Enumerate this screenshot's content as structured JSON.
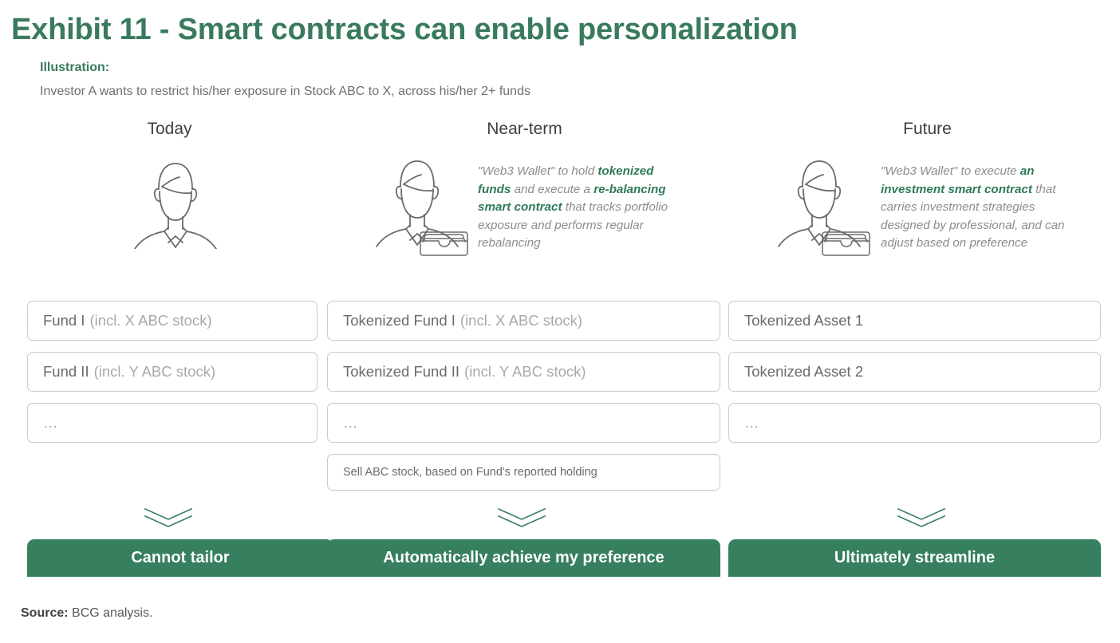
{
  "header": {
    "title": "Exhibit 11 - Smart contracts can enable personalization",
    "illustration_label": "Illustration:",
    "illustration_text": "Investor A wants to restrict his/her exposure in Stock ABC to X, across his/her 2+ funds"
  },
  "colors": {
    "brand_green": "#3a7a5e",
    "bar_green": "#367f5f",
    "highlight_green": "#2f7a57",
    "body_gray": "#6d6e71",
    "muted_gray": "#a7a9ab",
    "box_border": "#c9cacb",
    "icon_stroke": "#6a6b6d"
  },
  "columns": [
    {
      "header": "Today",
      "icon": "person-icon",
      "has_wallet": false,
      "description_plain": "",
      "description_parts": [],
      "items": [
        {
          "main": "Fund I",
          "sub": "(incl. X ABC stock)",
          "style": "normal"
        },
        {
          "main": "Fund II",
          "sub": "(incl. Y ABC stock)",
          "style": "normal"
        },
        {
          "main": "…",
          "sub": "",
          "style": "ellipsis"
        }
      ],
      "chevron": "double-chevron-down-icon",
      "footer": "Cannot tailor"
    },
    {
      "header": "Near-term",
      "icon": "person-with-wallet-icon",
      "has_wallet": true,
      "description_plain": "\"Web3 Wallet\" to hold tokenized funds and execute a re-balancing smart contract that tracks portfolio exposure and performs regular rebalancing",
      "description_parts": [
        {
          "text": "\"Web3 Wallet\" to hold ",
          "bold": false
        },
        {
          "text": "tokenized funds",
          "bold": true
        },
        {
          "text": " and execute a ",
          "bold": false
        },
        {
          "text": "re-balancing smart contract",
          "bold": true
        },
        {
          "text": " that tracks portfolio exposure and performs regular rebalancing",
          "bold": false
        }
      ],
      "items": [
        {
          "main": "Tokenized Fund I",
          "sub": "(incl. X ABC stock)",
          "style": "normal"
        },
        {
          "main": "Tokenized Fund II",
          "sub": "(incl. Y ABC stock)",
          "style": "normal"
        },
        {
          "main": "…",
          "sub": "",
          "style": "ellipsis"
        },
        {
          "main": "Sell ABC stock, based on Fund's reported holding",
          "sub": "",
          "style": "small"
        }
      ],
      "chevron": "double-chevron-down-icon",
      "footer": "Automatically achieve my preference"
    },
    {
      "header": "Future",
      "icon": "person-with-wallet-icon",
      "has_wallet": true,
      "description_plain": "\"Web3 Wallet\" to execute an investment smart contract that carries investment strategies designed by professional, and can adjust based on preference",
      "description_parts": [
        {
          "text": "\"Web3 Wallet\" to execute ",
          "bold": false
        },
        {
          "text": "an investment smart contract",
          "bold": true
        },
        {
          "text": " that carries investment strategies designed by professional, and can adjust based on preference",
          "bold": false
        }
      ],
      "items": [
        {
          "main": "Tokenized Asset 1",
          "sub": "",
          "style": "normal"
        },
        {
          "main": "Tokenized Asset 2",
          "sub": "",
          "style": "normal"
        },
        {
          "main": "…",
          "sub": "",
          "style": "ellipsis"
        }
      ],
      "chevron": "double-chevron-down-icon",
      "footer": "Ultimately streamline"
    }
  ],
  "source": {
    "label": "Source:",
    "text": "BCG analysis."
  }
}
